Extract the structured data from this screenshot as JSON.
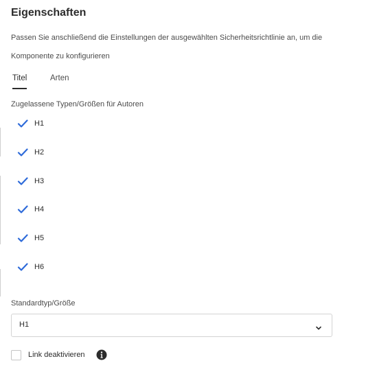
{
  "panel": {
    "title": "Eigenschaften",
    "description": "Passen Sie anschließend die Einstellungen der ausgewählten Sicherheitsrichtlinie an, um die Komponente zu konfigurieren"
  },
  "tabs": [
    {
      "label": "Titel",
      "active": true
    },
    {
      "label": "Arten",
      "active": false
    }
  ],
  "allowed_types": {
    "label": "Zugelassene Typen/Größen für Autoren",
    "items": [
      {
        "label": "H1",
        "checked": true
      },
      {
        "label": "H2",
        "checked": true
      },
      {
        "label": "H3",
        "checked": true
      },
      {
        "label": "H4",
        "checked": true
      },
      {
        "label": "H5",
        "checked": true
      },
      {
        "label": "H6",
        "checked": true
      }
    ]
  },
  "default_type": {
    "label": "Standardtyp/Größe",
    "value": "H1",
    "icon": "chevron-down-icon"
  },
  "link": {
    "label": "Link deaktivieren",
    "checked": false,
    "icon": "info-icon"
  },
  "colors": {
    "check": "#2d6ad9",
    "text": "#2c2c2c"
  }
}
